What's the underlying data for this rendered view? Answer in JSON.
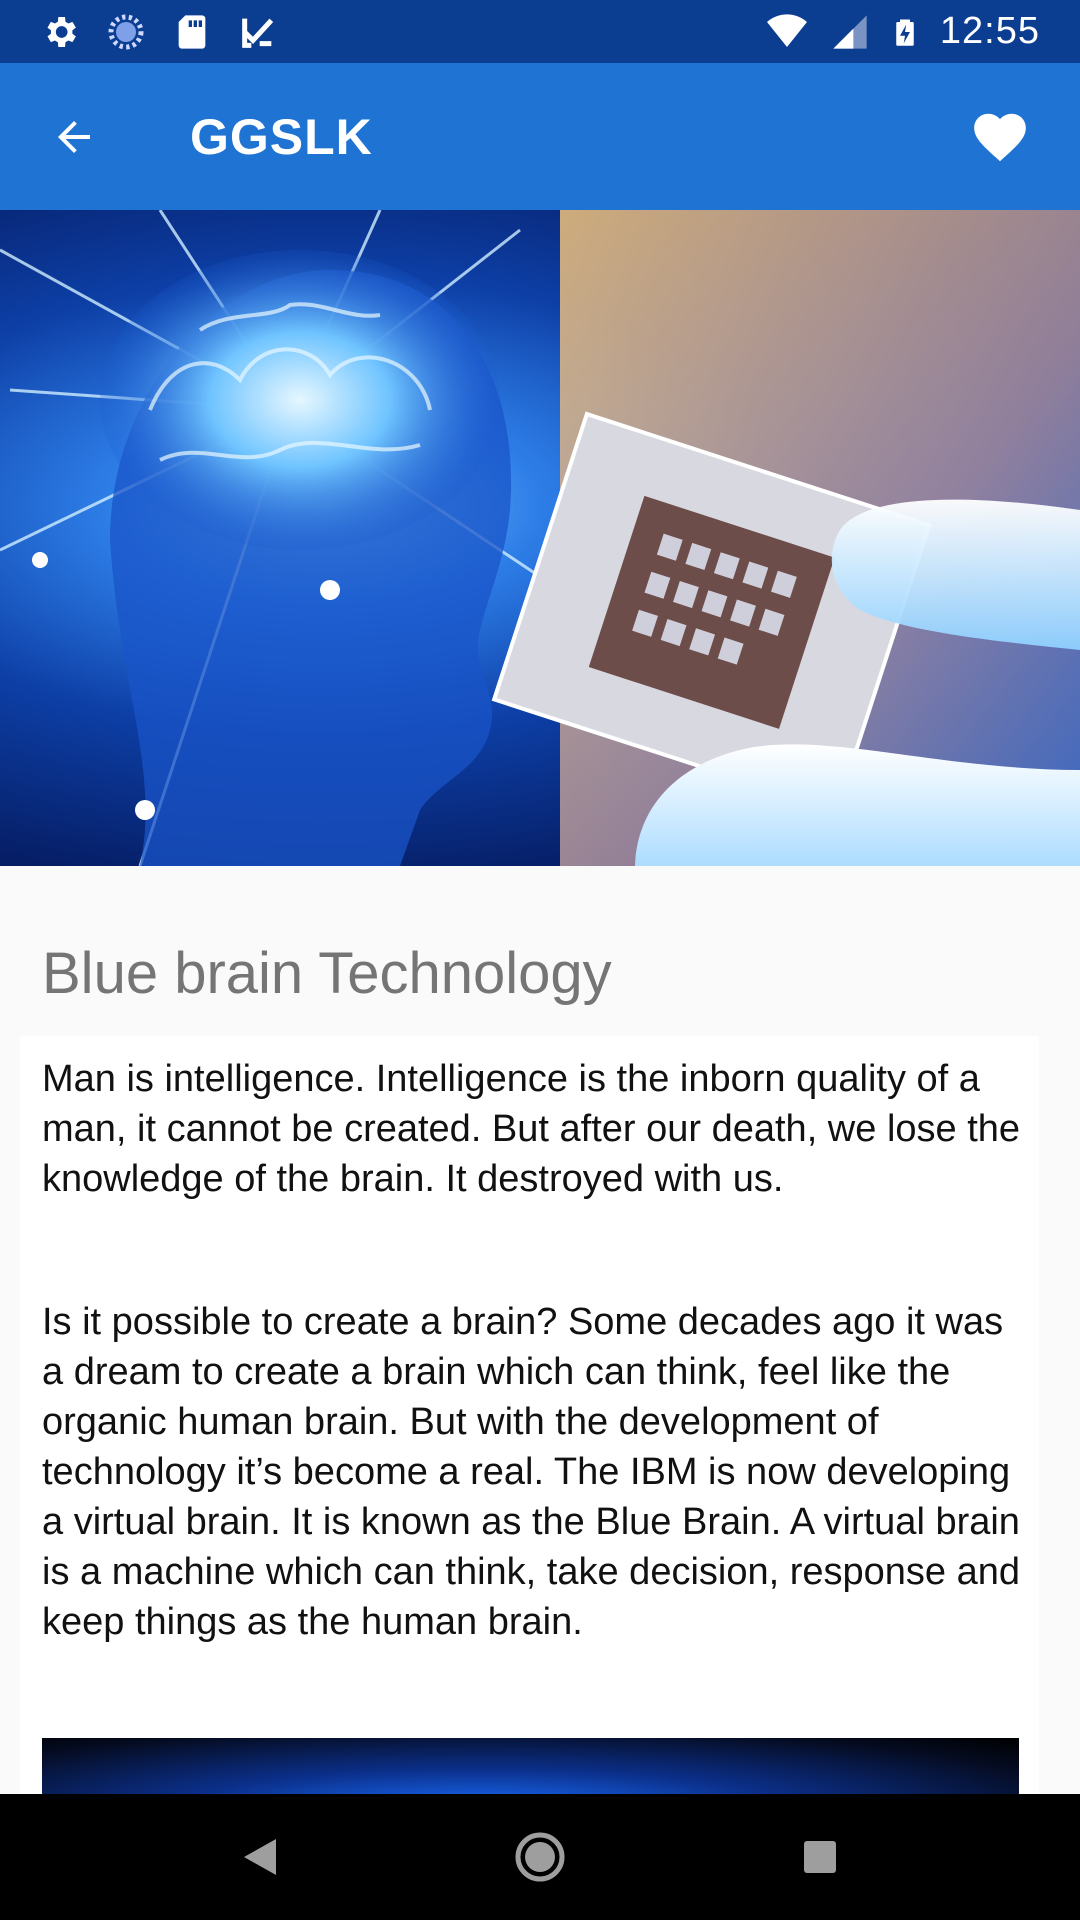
{
  "status_bar": {
    "time": "12:55",
    "left_icons": [
      "settings-icon",
      "sync-icon",
      "sd-card-icon",
      "checklist-icon"
    ],
    "right_icons": [
      "wifi-icon",
      "cellular-signal-icon",
      "battery-charging-icon"
    ]
  },
  "app_bar": {
    "title": "GGSLK",
    "back_icon": "arrow-back-icon",
    "favorite_icon": "heart-icon",
    "color": "#1f73d3"
  },
  "hero_image": {
    "description_icon": "brain-chip-illustration"
  },
  "article": {
    "title": "Blue brain Technology",
    "paragraphs": [
      "Man is intelligence. Intelligence is the inborn quality of a man, it cannot be created. But after our death, we lose the knowledge of the brain. It destroyed with us.",
      "Is it possible to create a brain? Some decades ago it was a dream to create a brain which can think, feel like the organic human brain. But with the development of technology it’s become a real. The IBM is now developing a virtual brain. It is known as the Blue Brain. A virtual brain is a machine which can think, take decision, response and keep things as the human brain."
    ]
  },
  "nav_bar": {
    "buttons": [
      "back-triangle-icon",
      "home-circle-icon",
      "recents-square-icon"
    ]
  }
}
